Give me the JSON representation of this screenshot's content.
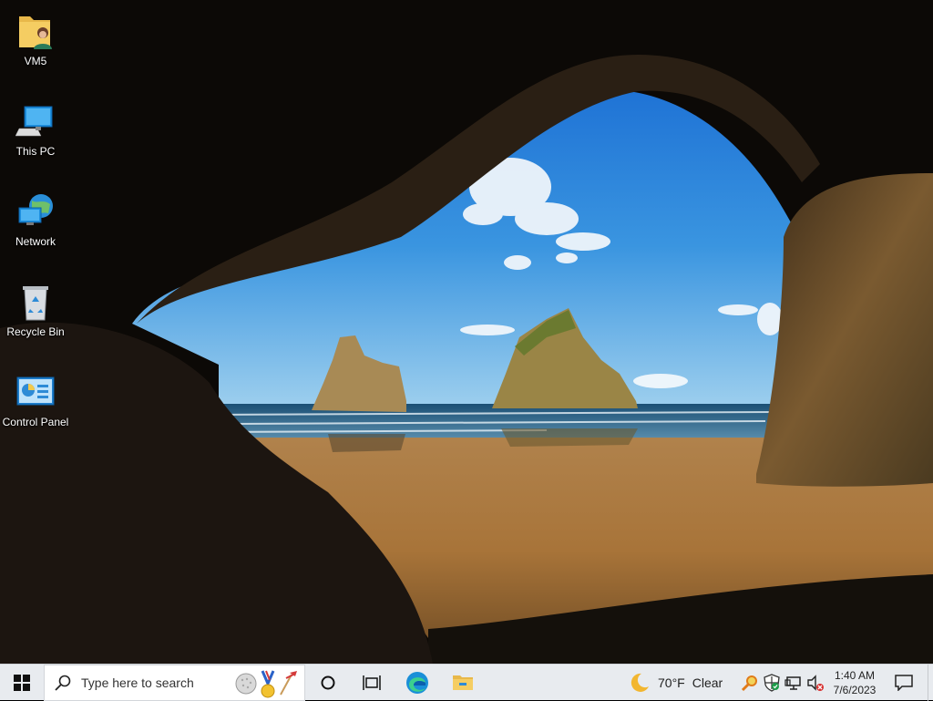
{
  "desktop": {
    "icons": [
      {
        "label": "VM5",
        "icon": "user-folder-icon"
      },
      {
        "label": "This PC",
        "icon": "computer-icon"
      },
      {
        "label": "Network",
        "icon": "network-icon"
      },
      {
        "label": "Recycle Bin",
        "icon": "recycle-bin-icon"
      },
      {
        "label": "Control Panel",
        "icon": "control-panel-icon"
      }
    ]
  },
  "taskbar": {
    "search_placeholder": "Type here to search",
    "weather": {
      "temp": "70°F",
      "condition": "Clear"
    },
    "clock": {
      "time": "1:40 AM",
      "date": "7/6/2023"
    }
  },
  "colors": {
    "taskbar_bg": "#e8ebef",
    "windows_blue": "#0078d7"
  }
}
